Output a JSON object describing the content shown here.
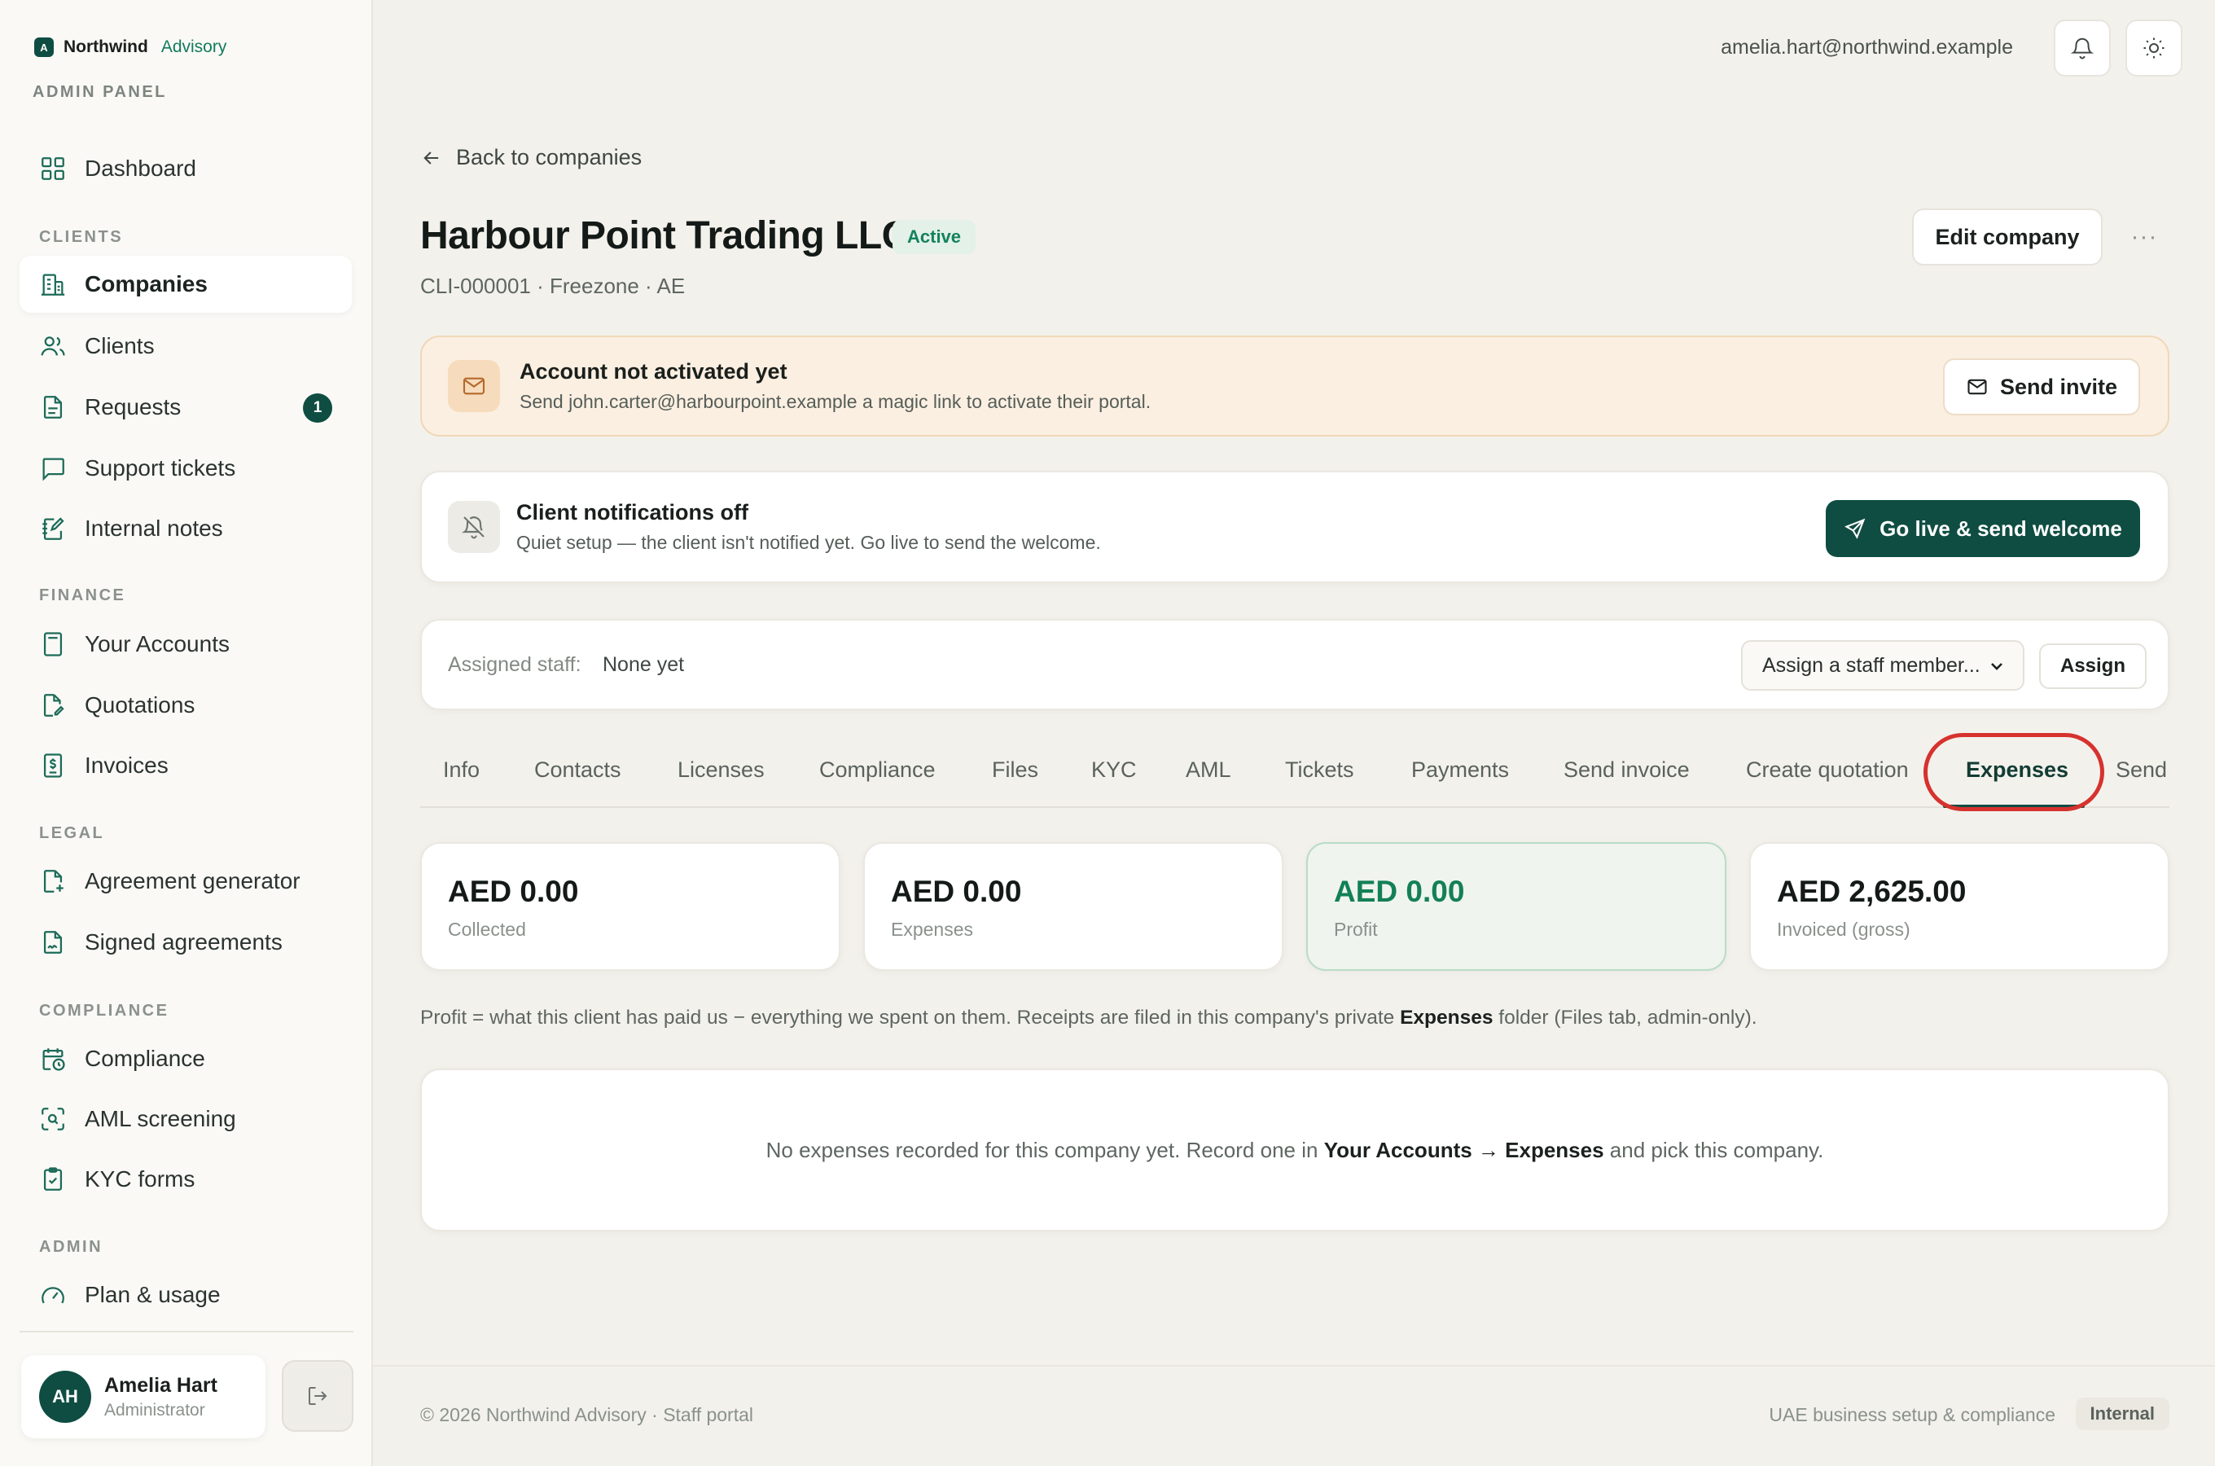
{
  "brand": {
    "mark": "A",
    "name": "Northwind",
    "sub": "Advisory",
    "panel_label": "ADMIN PANEL"
  },
  "sidebar": {
    "dashboard": "Dashboard",
    "sections": {
      "clients": "CLIENTS",
      "finance": "FINANCE",
      "legal": "LEGAL",
      "compliance": "COMPLIANCE",
      "admin": "ADMIN"
    },
    "items": {
      "companies": "Companies",
      "clients": "Clients",
      "requests": "Requests",
      "requests_badge": "1",
      "support_tickets": "Support tickets",
      "internal_notes": "Internal notes",
      "your_accounts": "Your Accounts",
      "quotations": "Quotations",
      "invoices": "Invoices",
      "agreement_generator": "Agreement generator",
      "signed_agreements": "Signed agreements",
      "compliance": "Compliance",
      "aml_screening": "AML screening",
      "kyc_forms": "KYC forms",
      "plan_usage": "Plan & usage"
    },
    "active": "companies"
  },
  "user": {
    "initials": "AH",
    "name": "Amelia Hart",
    "role": "Administrator"
  },
  "topbar": {
    "email": "amelia.hart@northwind.example",
    "icons": [
      "bell-icon",
      "sun-icon"
    ]
  },
  "page": {
    "back_label": "Back to companies",
    "company_name": "Harbour Point Trading LLC",
    "status": "Active",
    "meta": "CLI-000001 · Freezone · AE",
    "edit_label": "Edit company",
    "more_label": "···"
  },
  "activation_banner": {
    "title": "Account not activated yet",
    "subtitle": "Send john.carter@harbourpoint.example a magic link to activate their portal.",
    "button": "Send invite"
  },
  "notifications_banner": {
    "title": "Client notifications off",
    "subtitle": "Quiet setup — the client isn't notified yet. Go live to send the welcome.",
    "button": "Go live & send welcome"
  },
  "staff": {
    "label": "Assigned staff:",
    "value": "None yet",
    "select_value": "Assign a staff member...",
    "assign_label": "Assign"
  },
  "tabs": [
    "Info",
    "Contacts",
    "Licenses",
    "Compliance",
    "Files",
    "KYC",
    "AML",
    "Tickets",
    "Payments",
    "Send invoice",
    "Create quotation",
    "Expenses",
    "Send"
  ],
  "active_tab": "Expenses",
  "stats": [
    {
      "value": "AED 0.00",
      "label": "Collected"
    },
    {
      "value": "AED 0.00",
      "label": "Expenses"
    },
    {
      "value": "AED 0.00",
      "label": "Profit"
    },
    {
      "value": "AED 2,625.00",
      "label": "Invoiced (gross)"
    }
  ],
  "profit_note": {
    "before": "Profit = what this client has paid us − everything we spent on them. Receipts are filed in this company's private ",
    "strong": "Expenses",
    "after": " folder (Files tab, admin-only)."
  },
  "empty_state": {
    "before": "No expenses recorded for this company yet. Record one in ",
    "strong": "Your Accounts → Expenses",
    "after": " and pick this company."
  },
  "footer": {
    "left": "© 2026 Northwind Advisory · Staff portal",
    "right": "UAE business setup & compliance",
    "badge": "Internal"
  },
  "colors": {
    "brand": "#0f4d42",
    "accent_green": "#138056",
    "warning_bg": "#fbefe1",
    "highlight_ring": "#d6322e"
  }
}
